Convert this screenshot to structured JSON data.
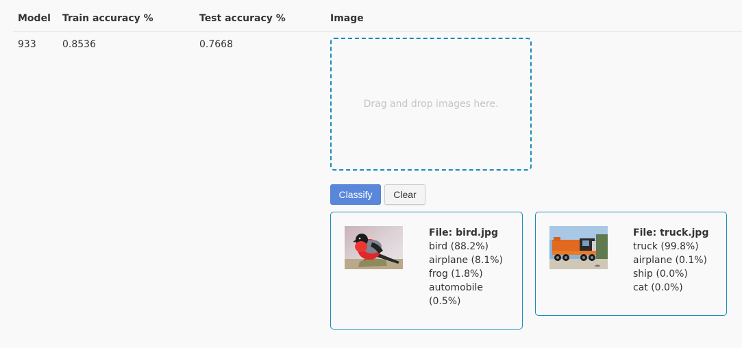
{
  "table": {
    "headers": {
      "model": "Model",
      "train": "Train accuracy %",
      "test": "Test accuracy %",
      "image": "Image"
    },
    "row": {
      "model": "933",
      "train": "0.8536",
      "test": "0.7668"
    }
  },
  "dropzone": {
    "text": "Drag and drop images here."
  },
  "buttons": {
    "classify": "Classify",
    "clear": "Clear"
  },
  "results": [
    {
      "file_label": "File: bird.jpg",
      "thumbnail": "bullfinch-bird-photo",
      "predictions": [
        "bird (88.2%)",
        "airplane (8.1%)",
        "frog (1.8%)",
        "automobile (0.5%)"
      ]
    },
    {
      "file_label": "File: truck.jpg",
      "thumbnail": "tow-truck-photo",
      "predictions": [
        "truck (99.8%)",
        "airplane (0.1%)",
        "ship (0.0%)",
        "cat (0.0%)"
      ]
    }
  ],
  "colors": {
    "accent_border": "#1a8ab8",
    "primary_button": "#5a87da",
    "background": "#f9f9f9"
  }
}
